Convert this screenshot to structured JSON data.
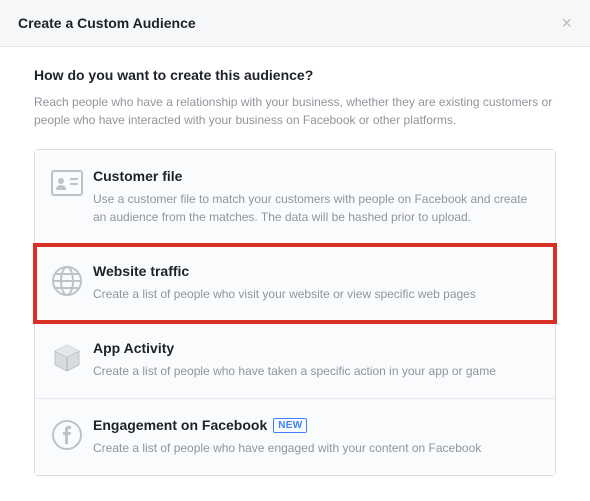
{
  "header": {
    "title": "Create a Custom Audience"
  },
  "main": {
    "question": "How do you want to create this audience?",
    "subtext": "Reach people who have a relationship with your business, whether they are existing customers or people who have interacted with your business on Facebook or other platforms."
  },
  "options": [
    {
      "title": "Customer file",
      "desc": "Use a customer file to match your customers with people on Facebook and create an audience from the matches. The data will be hashed prior to upload."
    },
    {
      "title": "Website traffic",
      "desc": "Create a list of people who visit your website or view specific web pages"
    },
    {
      "title": "App Activity",
      "desc": "Create a list of people who have taken a specific action in your app or game"
    },
    {
      "title": "Engagement on Facebook",
      "desc": "Create a list of people who have engaged with your content on Facebook",
      "badge": "NEW"
    }
  ]
}
